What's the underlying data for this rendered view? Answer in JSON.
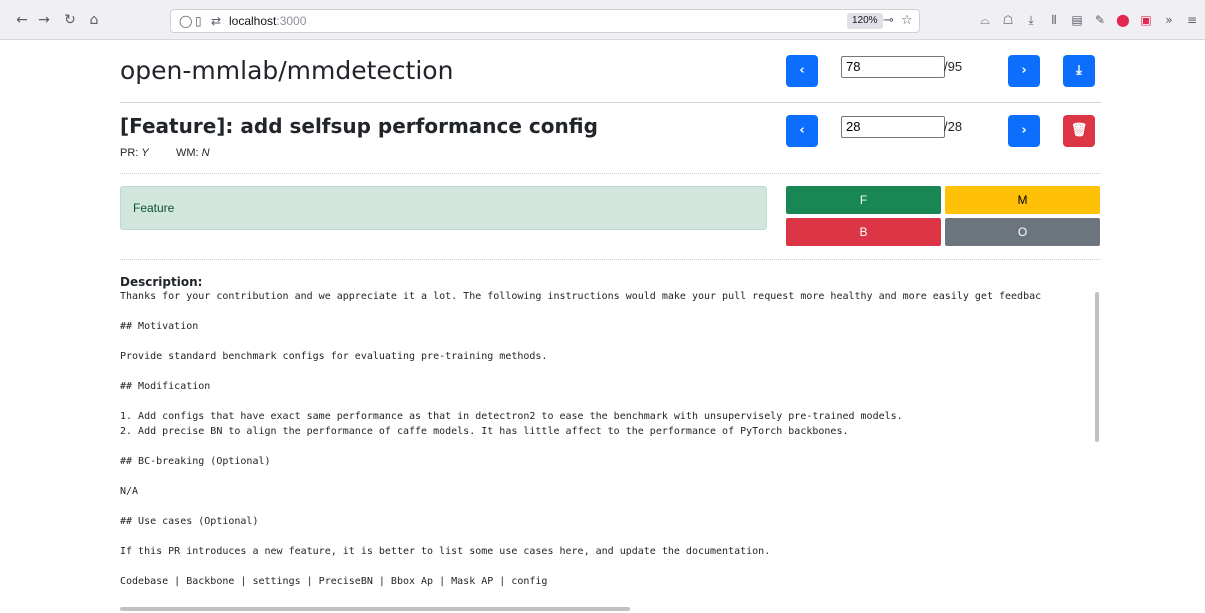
{
  "browser": {
    "url_host": "localhost",
    "url_port": ":3000",
    "zoom": "120%",
    "nav_icons": {
      "back": "arrow-left-icon",
      "forward": "arrow-right-icon",
      "reload": "reload-icon",
      "home": "home-icon"
    },
    "back_glyph": "←",
    "forward_glyph": "→",
    "reload_glyph": "↻",
    "home_glyph": "⌂",
    "shield_glyph": "◯",
    "page_glyph": "▯",
    "perm_glyph": "⇄",
    "key_glyph": "⊸",
    "star_glyph": "☆",
    "tools": [
      "⌓",
      "☖",
      "⤓",
      "⫴",
      "▤",
      "✎",
      "⬤",
      "▣",
      "»",
      "≡"
    ]
  },
  "repo": {
    "title": "open-mmlab/mmdetection",
    "index": "78",
    "total": "/95",
    "prev_glyph": "‹",
    "next_glyph": "›",
    "download_glyph": "⤓"
  },
  "pr": {
    "title": "[Feature]: add selfsup performance config",
    "index": "28",
    "total": "/28",
    "prev_glyph": "‹",
    "next_glyph": "›",
    "delete_glyph": "🗑",
    "pr_label": "PR:",
    "pr_value": "Y",
    "wm_label": "WM:",
    "wm_value": "N"
  },
  "label": {
    "current": "Feature",
    "colors": {
      "current_bg": "#d1e7dd",
      "current_text": "#0f5132"
    }
  },
  "categories": {
    "f": "F",
    "m": "M",
    "b": "B",
    "o": "O",
    "colors": {
      "f": "#198754",
      "m": "#ffc107",
      "b": "#dc3545",
      "o": "#6c757d"
    }
  },
  "description": {
    "label": "Description:",
    "text": "Thanks for your contribution and we appreciate it a lot. The following instructions would make your pull request more healthy and more easily get feedbac\n\n## Motivation\n\nProvide standard benchmark configs for evaluating pre-training methods.\n\n## Modification\n\n1. Add configs that have exact same performance as that in detectron2 to ease the benchmark with unsupervisely pre-trained models.\n2. Add precise BN to align the performance of caffe models. It has little affect to the performance of PyTorch backbones.\n\n## BC-breaking (Optional)\n\nN/A\n\n## Use cases (Optional)\n\nIf this PR introduces a new feature, it is better to list some use cases here, and update the documentation.\n\nCodebase | Backbone | settings | PreciseBN | Bbox Ap | Mask AP | config"
  }
}
